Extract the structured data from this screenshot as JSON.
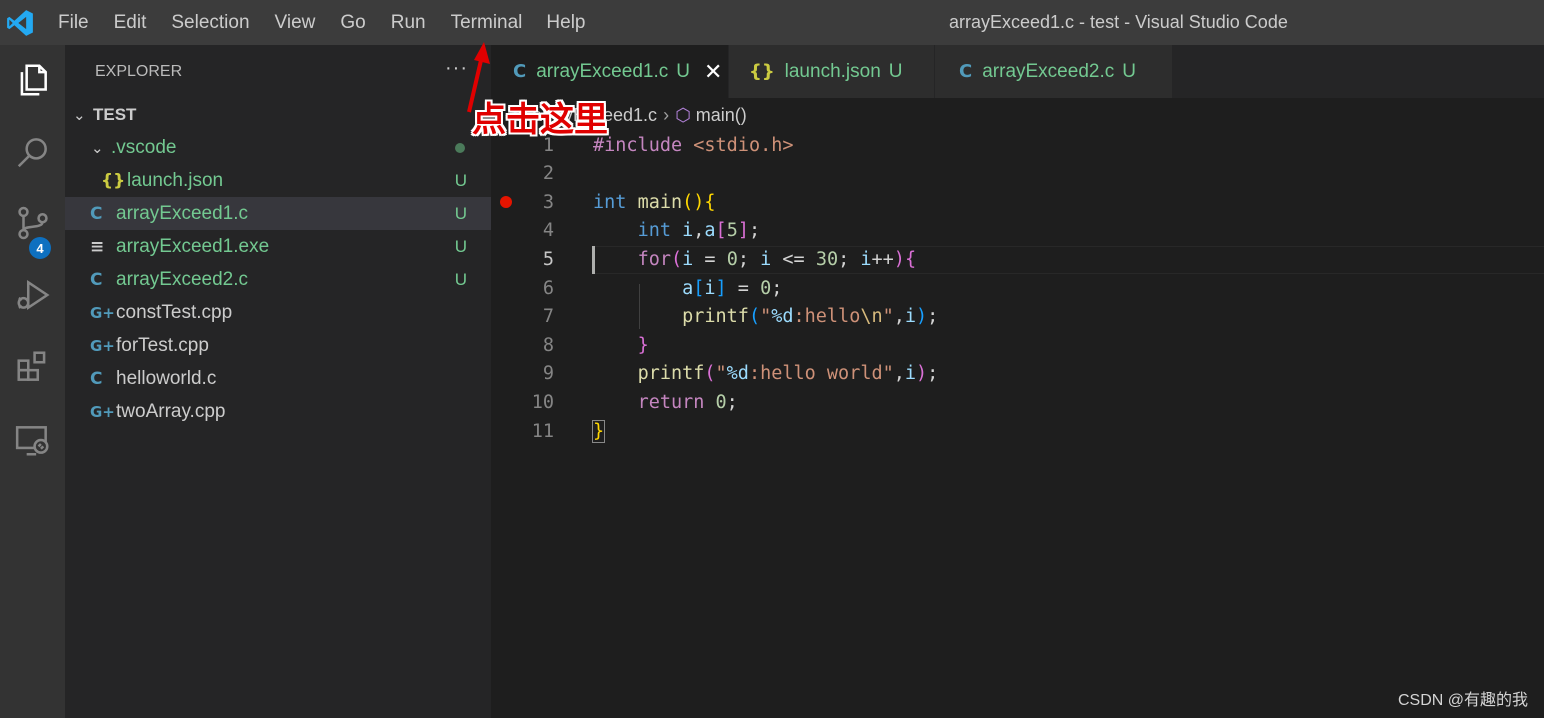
{
  "window_title": "arrayExceed1.c - test - Visual Studio Code",
  "menu": [
    "File",
    "Edit",
    "Selection",
    "View",
    "Go",
    "Run",
    "Terminal",
    "Help"
  ],
  "activity_bar": {
    "items": [
      "explorer-icon",
      "search-icon",
      "source-control-icon",
      "run-debug-icon",
      "extensions-icon",
      "remote-explorer-icon"
    ],
    "source_control_badge": "4"
  },
  "sidebar": {
    "title": "EXPLORER",
    "more": "···",
    "folder": "TEST",
    "items": [
      {
        "name": ".vscode",
        "status": "",
        "icon": "folder"
      },
      {
        "name": "launch.json",
        "status": "U",
        "icon": "json"
      },
      {
        "name": "arrayExceed1.c",
        "status": "U",
        "icon": "c"
      },
      {
        "name": "arrayExceed1.exe",
        "status": "U",
        "icon": "exe"
      },
      {
        "name": "arrayExceed2.c",
        "status": "U",
        "icon": "c"
      },
      {
        "name": "constTest.cpp",
        "status": "",
        "icon": "cpp"
      },
      {
        "name": "forTest.cpp",
        "status": "",
        "icon": "cpp"
      },
      {
        "name": "helloworld.c",
        "status": "",
        "icon": "c"
      },
      {
        "name": "twoArray.cpp",
        "status": "",
        "icon": "cpp"
      }
    ]
  },
  "tabs": [
    {
      "label": "arrayExceed1.c",
      "status": "U",
      "active": true
    },
    {
      "label": "launch.json",
      "status": "U",
      "active": false
    },
    {
      "label": "arrayExceed2.c",
      "status": "U",
      "active": false
    }
  ],
  "breadcrumb": {
    "file": "arrayExceed1.c",
    "symbol": "main()"
  },
  "editor": {
    "line_numbers": [
      "1",
      "2",
      "3",
      "4",
      "5",
      "6",
      "7",
      "8",
      "9",
      "10",
      "11"
    ],
    "current_line": 5,
    "breakpoint_line": 3
  },
  "annotation": "点击这里",
  "watermark": "CSDN @有趣的我",
  "colors": {
    "titlebar": "#3c3c3c",
    "activity_bar": "#333333",
    "sidebar": "#252526",
    "editor": "#1e1e1e",
    "untracked": "#73c991",
    "breakpoint": "#e51400",
    "badge": "#0e70c0",
    "annotation": "#e00000"
  }
}
